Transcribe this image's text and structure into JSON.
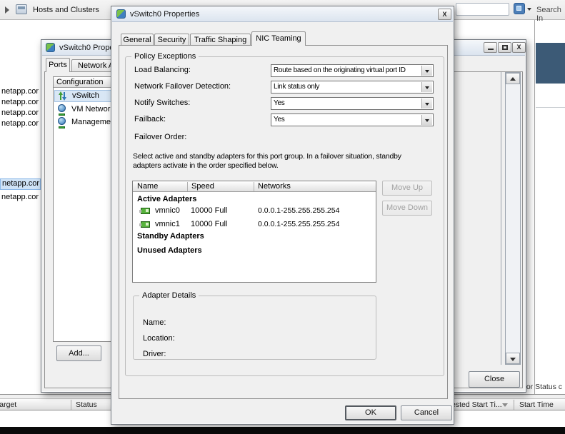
{
  "nav": {
    "breadcrumb": "Hosts and Clusters",
    "search_text": "Search In"
  },
  "tree": {
    "items": [
      "netapp.cor",
      "netapp.cor",
      "netapp.cor",
      "netapp.cor",
      "netapp.cor",
      "netapp.cor"
    ]
  },
  "back_dialog": {
    "title": "vSwitch0 Properties",
    "minimize_glyph": "",
    "maximize_glyph": "",
    "close_glyph": "X",
    "tab_ports": "Ports",
    "tab_network_adapters": "Network Adapters",
    "list_header": "Configuration",
    "items": [
      {
        "label": "vSwitch"
      },
      {
        "label": "VM Network"
      },
      {
        "label": "Management Network"
      }
    ],
    "add_label": "Add...",
    "close_label": "Close"
  },
  "front_dialog": {
    "title": "vSwitch0 Properties",
    "close_glyph": "X",
    "tabs": {
      "general": "General",
      "security": "Security",
      "traffic_shaping": "Traffic Shaping",
      "nic_teaming": "NIC Teaming"
    },
    "policy": {
      "group_label": "Policy Exceptions",
      "rows": [
        {
          "label": "Load Balancing:",
          "value": "Route based on the originating virtual port ID"
        },
        {
          "label": "Network Failover Detection:",
          "value": "Link status only"
        },
        {
          "label": "Notify Switches:",
          "value": "Yes"
        },
        {
          "label": "Failback:",
          "value": "Yes"
        }
      ],
      "failover_order_label": "Failover Order:",
      "description_line1": "Select active and standby adapters for this port group.  In a failover situation, standby",
      "description_line2": "adapters activate  in the order specified below."
    },
    "adapters_table": {
      "col_name": "Name",
      "col_speed": "Speed",
      "col_networks": "Networks",
      "group_active": "Active Adapters",
      "rows": [
        {
          "name": "vmnic0",
          "speed": "10000 Full",
          "networks": "0.0.0.1-255.255.255.254"
        },
        {
          "name": "vmnic1",
          "speed": "10000 Full",
          "networks": "0.0.0.1-255.255.255.254"
        }
      ],
      "group_standby": "Standby Adapters",
      "group_unused": "Unused Adapters",
      "move_up_label": "Move Up",
      "move_down_label": "Move Down"
    },
    "adapter_details": {
      "group_label": "Adapter Details",
      "name_label": "Name:",
      "location_label": "Location:",
      "driver_label": "Driver:"
    },
    "ok_label": "OK",
    "cancel_label": "Cancel"
  },
  "tasks": {
    "col_target": "Target",
    "col_status": "Status",
    "col_requested_start_fragment": "ested Start Ti...",
    "col_start_time": "Start Time",
    "filter_fragment": "t or Status c"
  },
  "colors": {
    "right_panel_header": "#3c5a76",
    "selection": "#cfe3f7",
    "nic_green": "#57b33c"
  }
}
